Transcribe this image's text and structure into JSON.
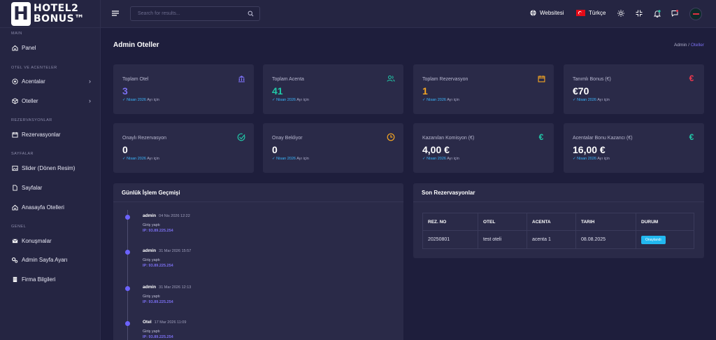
{
  "logo": {
    "letter": "H",
    "line1": "HOTEL2",
    "line2": "BONUS™"
  },
  "sidebar": {
    "sections": [
      "MAIN",
      "OTEL VE ACENTELER",
      "REZERVASYONLAR",
      "SAYFALAR",
      "GENEL"
    ],
    "items": [
      {
        "label": "Panel",
        "icon": "home-icon"
      },
      {
        "label": "Acentalar",
        "icon": "agency-icon"
      },
      {
        "label": "Oteller",
        "icon": "cube-icon"
      },
      {
        "label": "Rezervasyonlar",
        "icon": "calendar-icon"
      },
      {
        "label": "Slider (Dönen Resim)",
        "icon": "image-icon"
      },
      {
        "label": "Sayfalar",
        "icon": "file-icon"
      },
      {
        "label": "Anasayfa Otelleri",
        "icon": "home-icon"
      },
      {
        "label": "Konuşmalar",
        "icon": "mail-icon"
      },
      {
        "label": "Admin Sayfa Ayarı",
        "icon": "cogs-icon"
      },
      {
        "label": "Firma Bilgileri",
        "icon": "building-icon"
      }
    ]
  },
  "topbar": {
    "search_placeholder": "Search for results...",
    "website": "Websitesi",
    "language": "Türkçe"
  },
  "page": {
    "title": "Admin Oteller",
    "breadcrumb": {
      "home": "Admin",
      "sep": "/",
      "current": "Oteller"
    }
  },
  "cards": [
    {
      "label": "Toplam Otel",
      "value": "3",
      "month": "Nisan 2026",
      "suffix": "Ayı için",
      "icon": "bank-icon",
      "color": "#7a6ff0"
    },
    {
      "label": "Toplam Acenta",
      "value": "41",
      "month": "Nisan 2026",
      "suffix": "Ayı için",
      "icon": "users-icon",
      "color": "#21c8a8"
    },
    {
      "label": "Toplam Rezervasyon",
      "value": "1",
      "month": "Nisan 2026",
      "suffix": "Ayı için",
      "icon": "calendar-icon",
      "color": "#f5a623"
    },
    {
      "label": "Tanımlı Bonus (€)",
      "value": "€70",
      "month": "Nisan 2026",
      "suffix": "Ayı için",
      "icon": "euro-icon",
      "color": "#f0384e"
    },
    {
      "label": "Onaylı Rezervasyon",
      "value": "0",
      "month": "Nisan 2026",
      "suffix": "Ayı için",
      "icon": "check-circle-icon",
      "color": "#21c8a8"
    },
    {
      "label": "Onay Bekliyor",
      "value": "0",
      "month": "Nisan 2026",
      "suffix": "Ayı için",
      "icon": "clock-icon",
      "color": "#f5a623"
    },
    {
      "label": "Kazanılan Komisyon (€)",
      "value": "4,00 €",
      "month": "Nisan 2026",
      "suffix": "Ayı için",
      "icon": "euro-icon",
      "color": "#21c8a8"
    },
    {
      "label": "Acentalar Bonu Kazancı (€)",
      "value": "16,00 €",
      "month": "Nisan 2026",
      "suffix": "Ayı için",
      "icon": "euro-icon",
      "color": "#21c8a8"
    }
  ],
  "timeline": {
    "title": "Günlük İşlem Geçmişi",
    "items": [
      {
        "user": "admin",
        "time": "04 Nis 2026 12:22",
        "action": "Giriş yaptı",
        "ip": "IP: 93.89.225.254"
      },
      {
        "user": "admin",
        "time": "31 Mar 2026 15:57",
        "action": "Giriş yaptı",
        "ip": "IP: 93.89.225.254"
      },
      {
        "user": "admin",
        "time": "31 Mar 2026 12:13",
        "action": "Giriş yaptı",
        "ip": "IP: 93.89.225.254"
      },
      {
        "user": "Otel",
        "time": "17 Mar 2026 11:09",
        "action": "Giriş yaptı",
        "ip": "IP: 93.89.225.254"
      }
    ]
  },
  "reservations": {
    "title": "Son Rezervasyonlar",
    "headers": [
      "REZ. NO",
      "OTEL",
      "ACENTA",
      "TARIH",
      "DURUM"
    ],
    "rows": [
      {
        "no": "20250801",
        "hotel": "test oteli",
        "agency": "acenta 1",
        "date": "08.08.2025",
        "status": "Onaylandı"
      }
    ]
  }
}
